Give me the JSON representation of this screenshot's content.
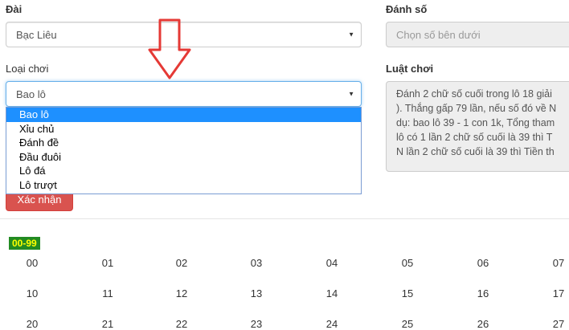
{
  "form": {
    "dai_label": "Đài",
    "dai_value": "Bạc Liêu",
    "danh_so_label": "Đánh số",
    "danh_so_placeholder": "Chọn số bên dưới",
    "loai_choi_label": "Loại chơi",
    "loai_choi_value": "Bao lô",
    "luat_choi_label": "Luật chơi",
    "luat_choi_lines": [
      "Đánh 2 chữ số cuối trong lô 18 giải",
      "). Thắng gấp 79 lần, nếu số đó về N",
      "dụ: bao lô 39 - 1 con 1k, Tổng tham",
      "lô có 1 lần 2 chữ số cuối là 39 thì T",
      "N lần 2 chữ số cuối là 39 thì Tiền th"
    ],
    "confirm_label": "Xác nhận"
  },
  "dropdown": {
    "options": [
      "Bao lô",
      "Xỉu chủ",
      "Đánh đề",
      "Đầu đuôi",
      "Lô đá",
      "Lô trượt"
    ],
    "selected_index": 0
  },
  "numbers": {
    "range_label": "00-99",
    "rows": [
      [
        "00",
        "01",
        "02",
        "03",
        "04",
        "05",
        "06",
        "07"
      ],
      [
        "10",
        "11",
        "12",
        "13",
        "14",
        "15",
        "16",
        "17"
      ],
      [
        "20",
        "21",
        "22",
        "23",
        "24",
        "25",
        "26",
        "27"
      ]
    ]
  },
  "colors": {
    "dropdown_selected": "#1e90ff",
    "confirm_button": "#d9534f",
    "range_badge_bg": "#228b22",
    "range_badge_text": "#ffff00",
    "annotation_arrow": "#e53935"
  },
  "annotation": {
    "icon": "down-arrow-icon"
  }
}
